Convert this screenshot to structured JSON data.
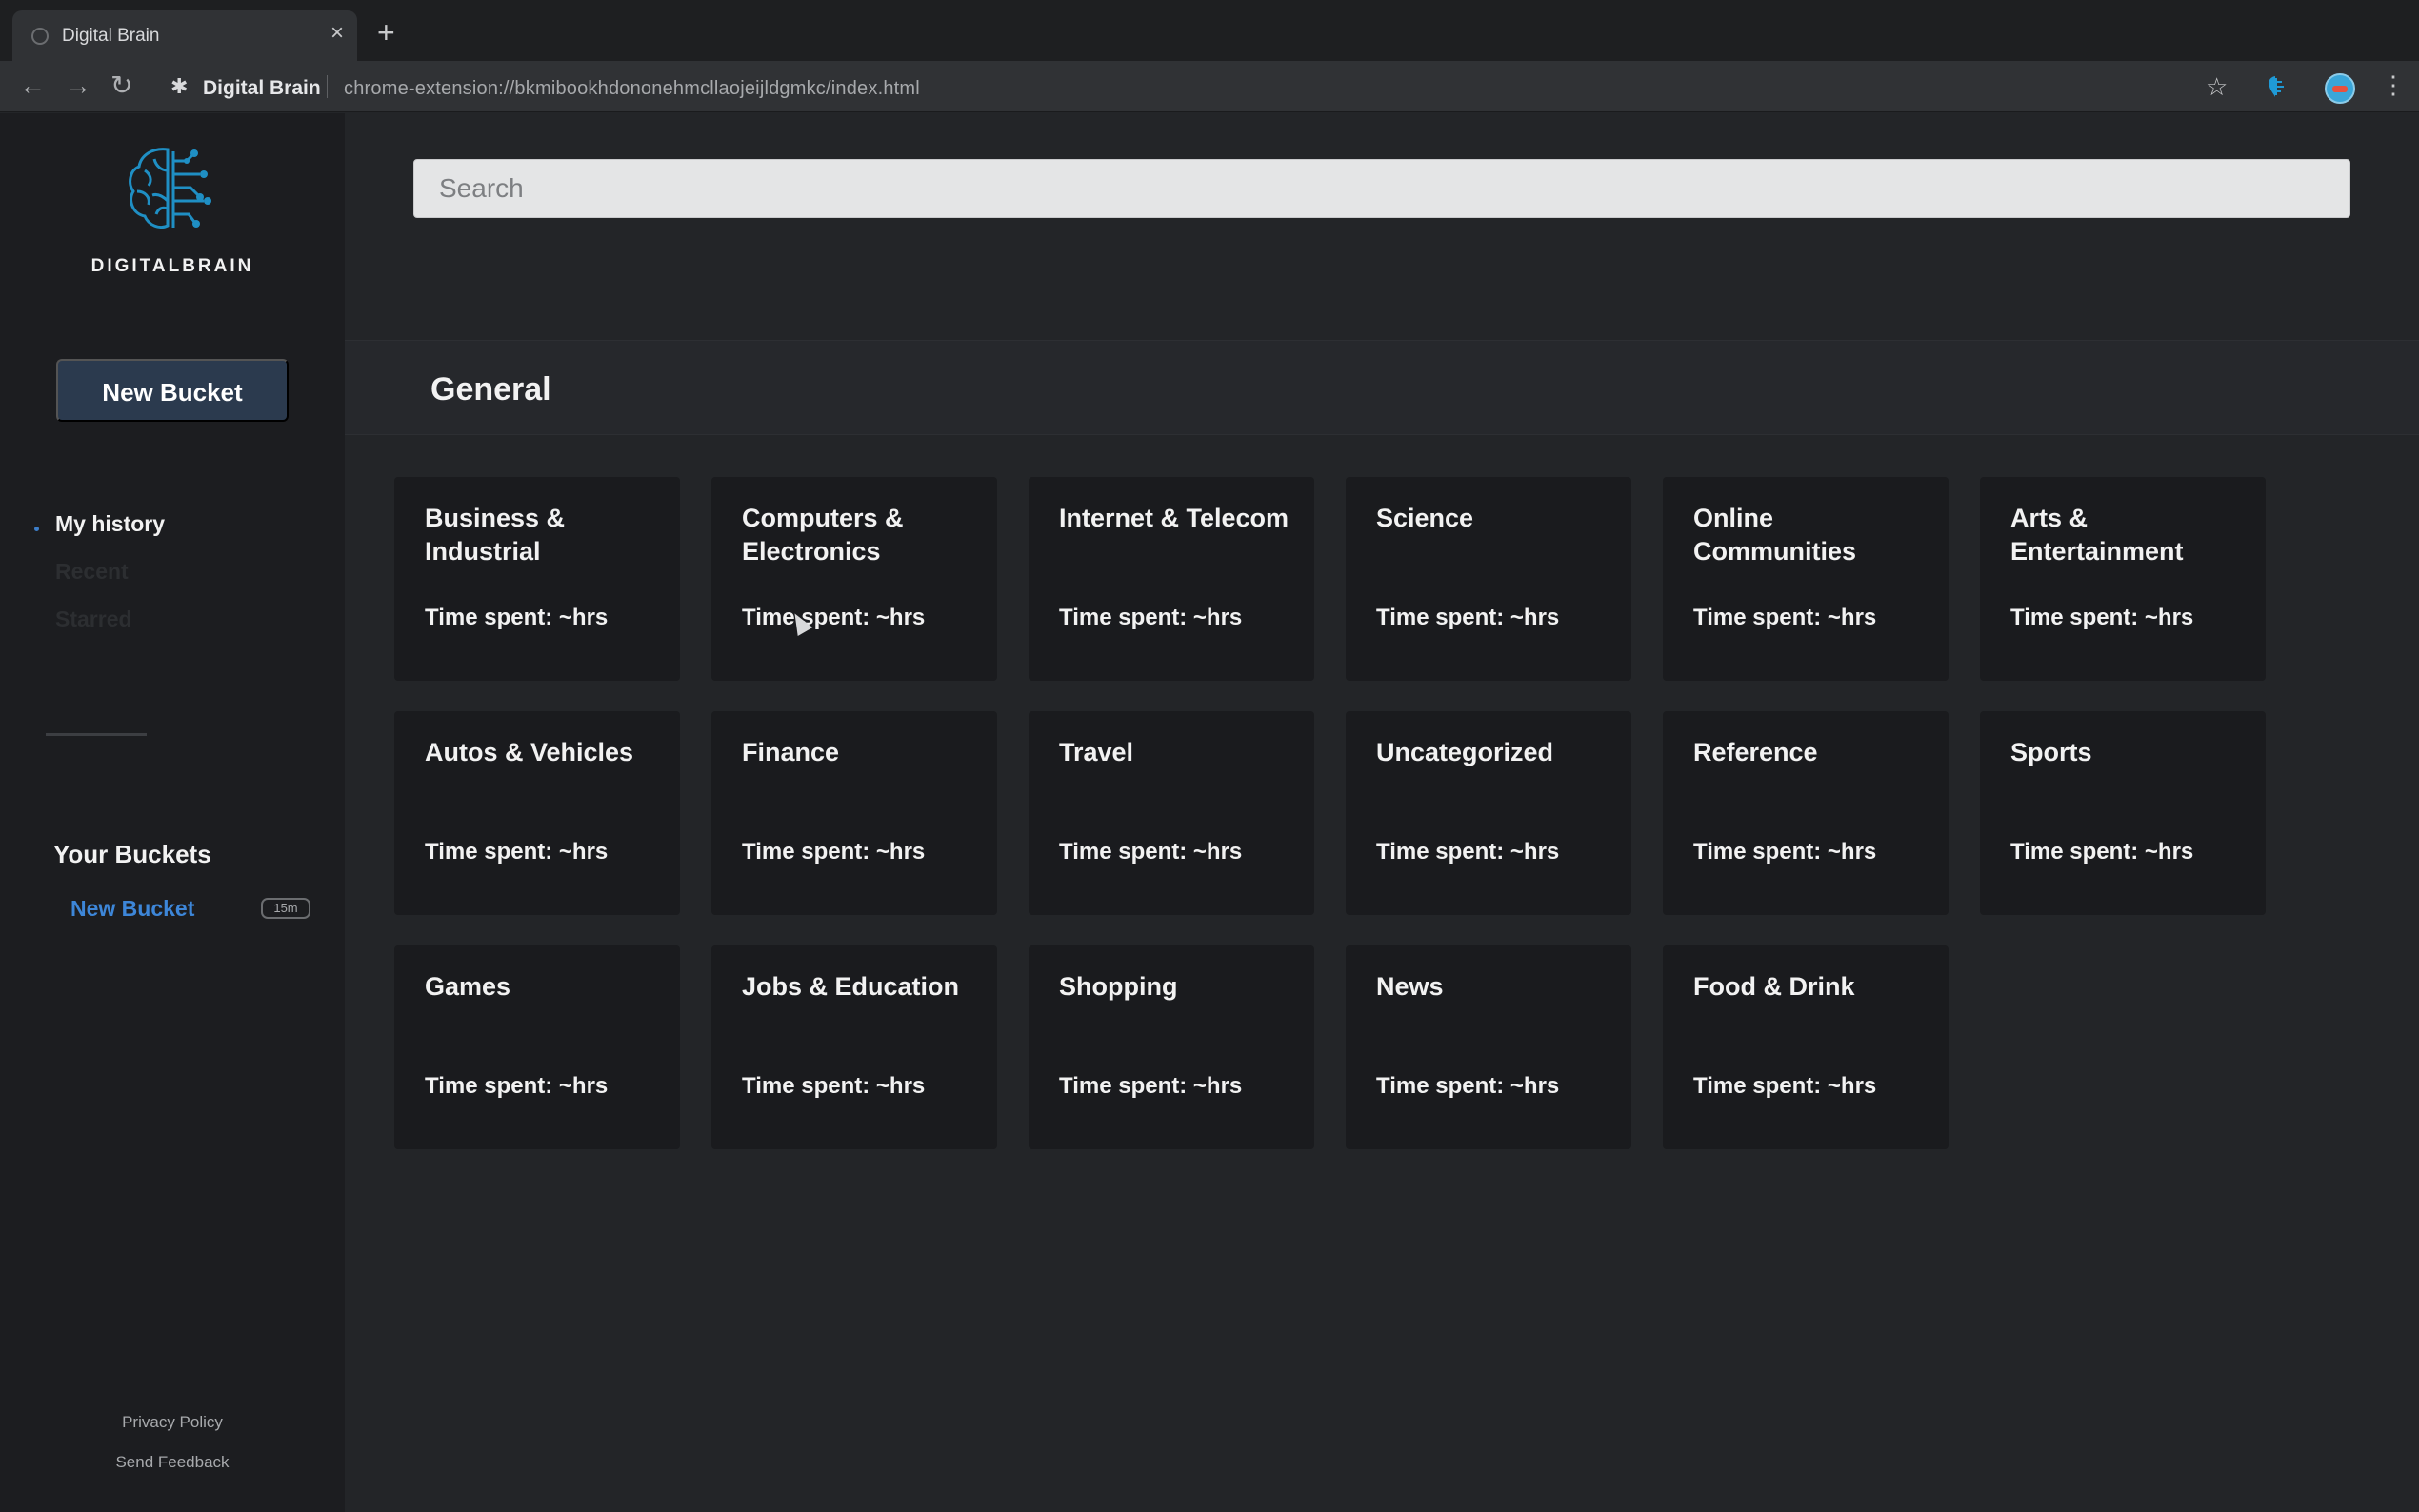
{
  "browser": {
    "tab_title": "Digital Brain",
    "tab_close": "×",
    "new_tab": "+",
    "back": "←",
    "forward": "→",
    "reload": "↻",
    "site_name": "Digital Brain",
    "url": "chrome-extension://bkmibookhdononehmcllaojeijldgmkc/index.html",
    "star": "☆",
    "menu": "⋮"
  },
  "sidebar": {
    "logo_text": "DIGITALBRAIN",
    "new_bucket_label": "New Bucket",
    "nav": [
      {
        "label": "My history"
      },
      {
        "label": "Recent"
      },
      {
        "label": "Starred"
      }
    ],
    "buckets_heading": "Your Buckets",
    "buckets": [
      {
        "name": "New Bucket",
        "time": "15m"
      }
    ],
    "footer": {
      "privacy": "Privacy Policy",
      "feedback": "Send Feedback"
    }
  },
  "main": {
    "search_placeholder": "Search",
    "section_title": "General",
    "categories": [
      {
        "name": "Business & Industrial",
        "time": "Time spent: ~hrs"
      },
      {
        "name": "Computers & Electronics",
        "time": "Time spent: ~hrs"
      },
      {
        "name": "Internet & Telecom",
        "time": "Time spent: ~hrs"
      },
      {
        "name": "Science",
        "time": "Time spent: ~hrs"
      },
      {
        "name": "Online Communities",
        "time": "Time spent: ~hrs"
      },
      {
        "name": "Arts & Entertainment",
        "time": "Time spent: ~hrs"
      },
      {
        "name": "Autos & Vehicles",
        "time": "Time spent: ~hrs"
      },
      {
        "name": "Finance",
        "time": "Time spent: ~hrs"
      },
      {
        "name": "Travel",
        "time": "Time spent: ~hrs"
      },
      {
        "name": "Uncategorized",
        "time": "Time spent: ~hrs"
      },
      {
        "name": "Reference",
        "time": "Time spent: ~hrs"
      },
      {
        "name": "Sports",
        "time": "Time spent: ~hrs"
      },
      {
        "name": "Games",
        "time": "Time spent: ~hrs"
      },
      {
        "name": "Jobs & Education",
        "time": "Time spent: ~hrs"
      },
      {
        "name": "Shopping",
        "time": "Time spent: ~hrs"
      },
      {
        "name": "News",
        "time": "Time spent: ~hrs"
      },
      {
        "name": "Food & Drink",
        "time": "Time spent: ~hrs"
      }
    ]
  },
  "colors": {
    "accent": "#3d86d8",
    "sidebar_bg": "#1c1d20",
    "card_bg": "#1a1b1e",
    "button_bg": "#2b3a4e"
  }
}
